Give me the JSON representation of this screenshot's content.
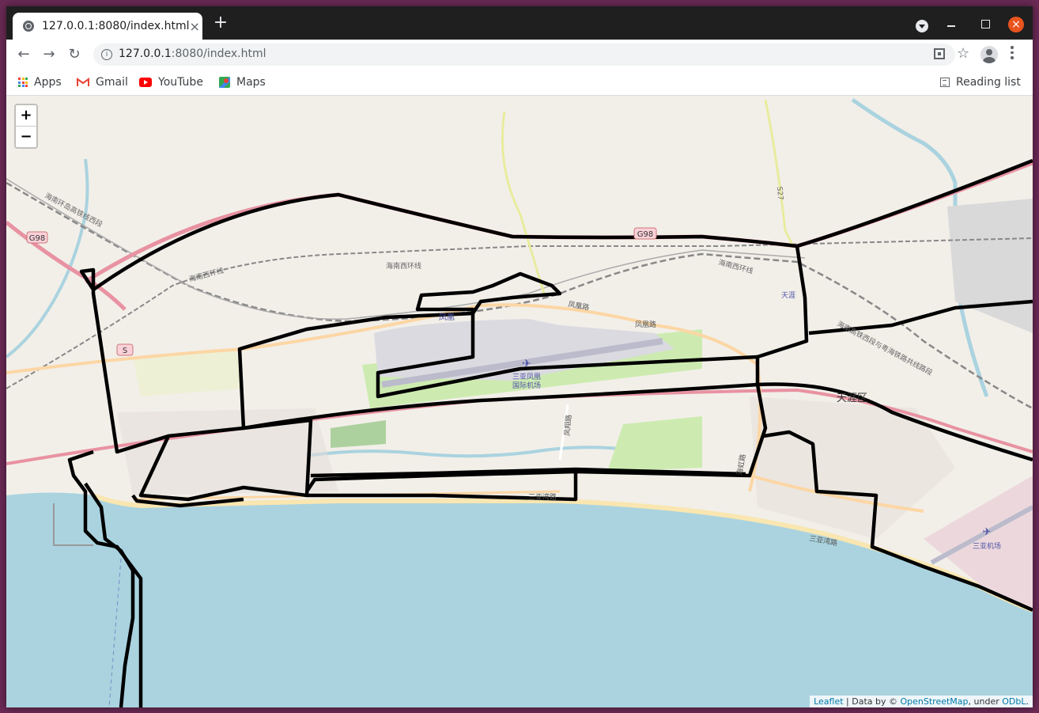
{
  "browser": {
    "tab_title": "127.0.0.1:8080/index.html",
    "tab_close": "×",
    "new_tab": "+",
    "url_host": "127.0.0.1",
    "url_rest": ":8080/index.html",
    "nav": {
      "back": "←",
      "forward": "→",
      "reload": "↻"
    },
    "window_close": "×"
  },
  "bookmarks": {
    "items": [
      {
        "label": "Apps",
        "icon": "apps-icon"
      },
      {
        "label": "Gmail",
        "icon": "gmail-icon"
      },
      {
        "label": "YouTube",
        "icon": "youtube-icon"
      },
      {
        "label": "Maps",
        "icon": "maps-icon"
      }
    ],
    "reading_list": "Reading list"
  },
  "map": {
    "zoom_in": "+",
    "zoom_out": "−",
    "attribution": {
      "leaflet": "Leaflet",
      "sep": " | Data by © ",
      "osm": "OpenStreetMap",
      "under": ", under ",
      "odbl": "ODbL",
      "end": "."
    },
    "labels": {
      "g98_left": "G98",
      "g98_top": "G98",
      "s": "S",
      "hainan_rail_w": "海南环岛高铁线西段",
      "hainan_rail_w2": "海南环岛高铁线西段",
      "west_ring_1": "海南西环线",
      "west_ring_2": "海南西环线",
      "west_ring_3": "海南西环线",
      "fenghuang": "凤凰",
      "fenghuang_rd": "凤凰路",
      "fenghuang_rd2": "凤凰路",
      "airport_1": "三亚凤凰",
      "airport_2": "国际机场",
      "tianya": "天涯",
      "tianya_district": "天涯区",
      "s27": "S27",
      "fenghuang_rd_v": "凤凰路",
      "sanya_bay_rd": "三亚湾路",
      "sanya_bay_rd2": "三亚湾路",
      "sanya_airport": "三亚机场",
      "rail_shared": "海南高铁西段与粤海铁路共线路段",
      "haihong_rd": "海虹路",
      "feng_rd": "凤翔路"
    },
    "colors": {
      "sea": "#aad3df",
      "land": "#f2efe9",
      "motorway": "#e892a2",
      "primary": "#fcd6a4",
      "track": "#000000",
      "airport": "#dadae0",
      "green": "#cdebb0"
    }
  }
}
